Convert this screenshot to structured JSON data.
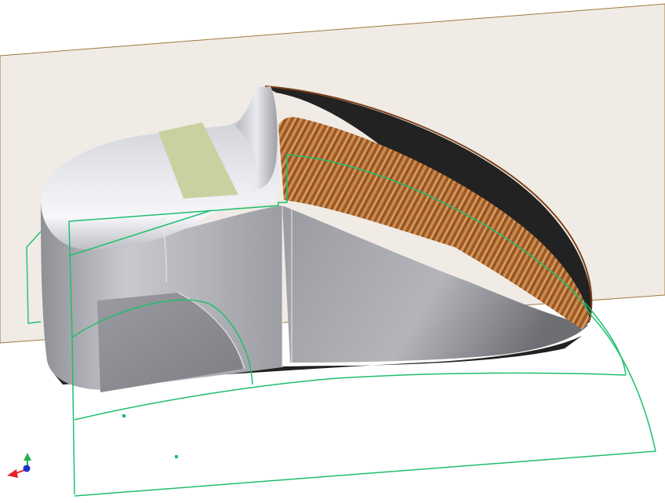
{
  "viewport": {
    "background": "#ffffff",
    "plane_fill": "#f0ebe5",
    "plane_edge": "#a07a3c",
    "body_light": "#cfd0d6",
    "body_mid": "#a3a4aa",
    "body_dark": "#7a7b80",
    "section_edge": "#222222",
    "sketch_color": "#1fbf6e",
    "tape_color": "#c9d1a0",
    "wood_light": "#c98a4a",
    "wood_dark": "#7c3f18"
  },
  "triad": {
    "x_axis_color": "#e8202a",
    "y_axis_color": "#20b050",
    "z_axis_color": "#2030d0",
    "x_axis_icon": "axis-x-arrow-icon",
    "y_axis_icon": "axis-y-arrow-icon",
    "z_axis_icon": "axis-z-dot-icon"
  }
}
